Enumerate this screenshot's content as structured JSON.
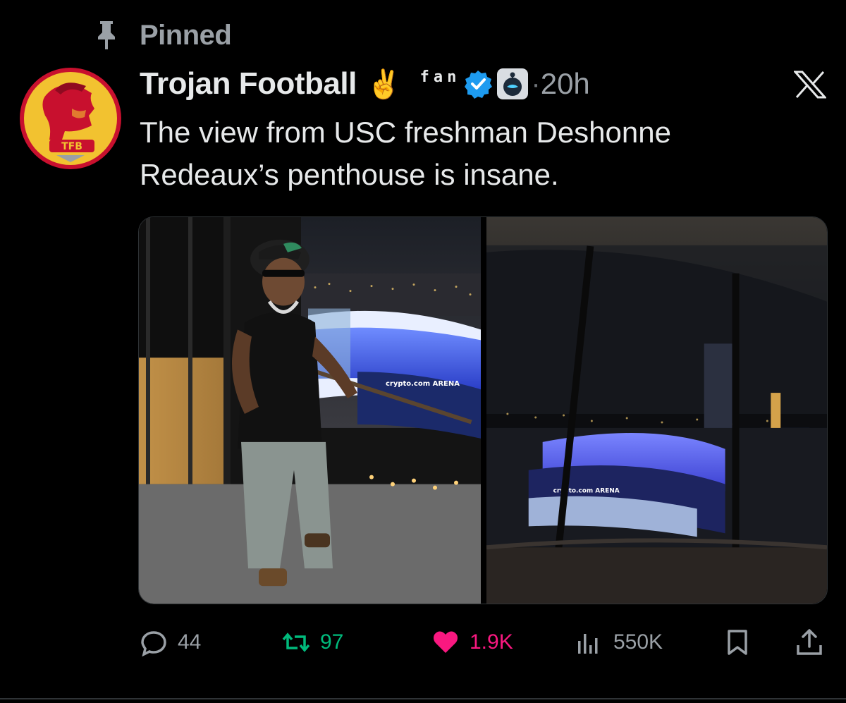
{
  "pinned": {
    "label": "Pinned"
  },
  "author": {
    "display_name": "Trojan Football",
    "emoji": "✌️",
    "fan_tag": "fan",
    "avatar_text": "TFB",
    "timestamp": "20h",
    "dot": "·"
  },
  "tweet": {
    "text": "The view from USC freshman Deshonne Redeaux’s penthouse is insane."
  },
  "media": {
    "left_image": "penthouse-balcony-photo",
    "right_image": "arena-night-view-photo",
    "signage_left": "crypto.com ARENA",
    "signage_right": "crypto.com ARENA"
  },
  "actions": {
    "replies": "44",
    "reposts": "97",
    "likes": "1.9K",
    "views": "550K"
  },
  "colors": {
    "background": "#000000",
    "text": "#e7e9ea",
    "muted": "#9aa0a6",
    "verified": "#1d9bf0",
    "repost": "#00ba7c",
    "like": "#f91880",
    "avatar_gold": "#f2c230",
    "avatar_red": "#c8102e"
  }
}
